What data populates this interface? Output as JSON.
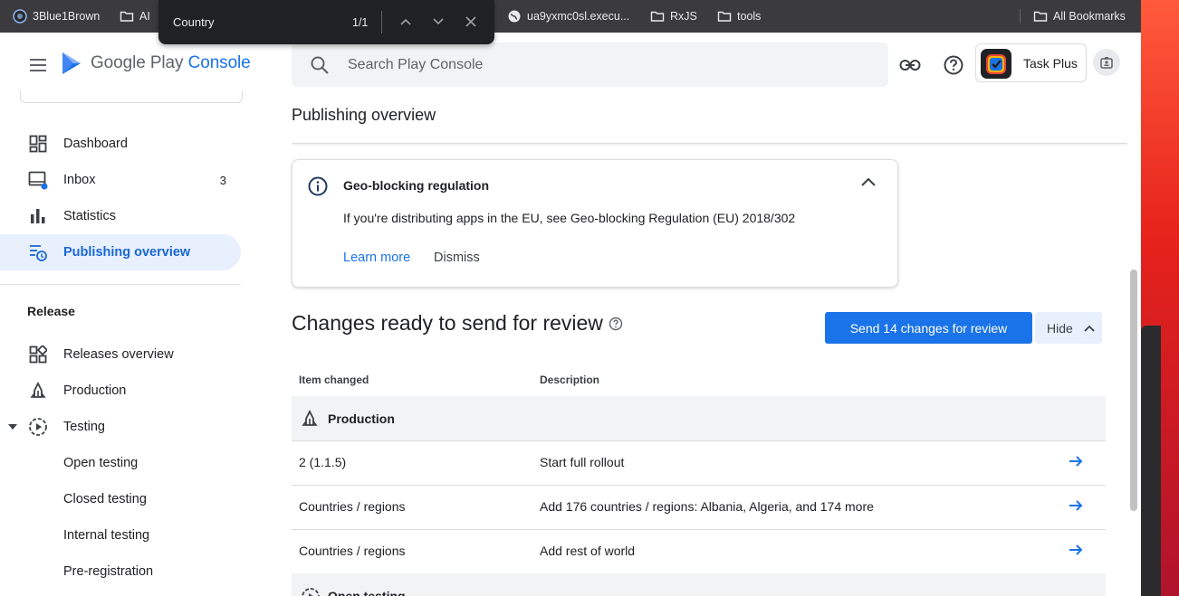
{
  "bookmarks": [
    {
      "label": "3Blue1Brown",
      "icon": "channel-icon"
    },
    {
      "label": "AI",
      "icon": "folder-icon"
    },
    {
      "label": "ua9yxmc0sl.execu...",
      "icon": "globe-icon"
    },
    {
      "label": "RxJS",
      "icon": "folder-icon"
    },
    {
      "label": "tools",
      "icon": "folder-icon"
    },
    {
      "label": "All Bookmarks",
      "icon": "folder-icon"
    }
  ],
  "find_bar": {
    "query": "Country",
    "count": "1/1"
  },
  "header": {
    "logo_prefix": "Google Play",
    "logo_suffix": "Console",
    "search_placeholder": "Search Play Console",
    "app_name": "Task Plus"
  },
  "sidebar": {
    "items": [
      {
        "label": "Dashboard",
        "icon": "dashboard-icon"
      },
      {
        "label": "Inbox",
        "icon": "inbox-icon",
        "badge": "3"
      },
      {
        "label": "Statistics",
        "icon": "bar-chart-icon"
      },
      {
        "label": "Publishing overview",
        "icon": "publishing-icon",
        "active": true
      }
    ],
    "section_release": "Release",
    "release_items": [
      {
        "label": "Releases overview",
        "icon": "releases-icon"
      },
      {
        "label": "Production",
        "icon": "production-icon"
      },
      {
        "label": "Testing",
        "icon": "testing-icon"
      }
    ],
    "testing_items": [
      "Open testing",
      "Closed testing",
      "Internal testing",
      "Pre-registration"
    ]
  },
  "main": {
    "page_title": "Publishing overview",
    "notice": {
      "title": "Geo-blocking regulation",
      "body": "If you're distributing apps in the EU, see Geo-blocking Regulation (EU) 2018/302",
      "learn_more": "Learn more",
      "dismiss": "Dismiss"
    },
    "changes_title": "Changes ready to send for review",
    "send_button": "Send 14 changes for review",
    "hide_button": "Hide",
    "table": {
      "headers": [
        "Item changed",
        "Description"
      ],
      "groups": [
        {
          "name": "Production",
          "rows": [
            {
              "item": "2 (1.1.5)",
              "description": "Start full rollout"
            },
            {
              "item": "Countries / regions",
              "description": "Add 176 countries / regions: Albania, Algeria, and 174 more"
            },
            {
              "item": "Countries / regions",
              "description": "Add rest of world"
            }
          ]
        },
        {
          "name": "Open testing",
          "rows": []
        }
      ]
    }
  },
  "colors": {
    "accent": "#1a73e8",
    "active_bg": "#e8f0fe",
    "bookmarks_bg": "#3b3b3d"
  }
}
